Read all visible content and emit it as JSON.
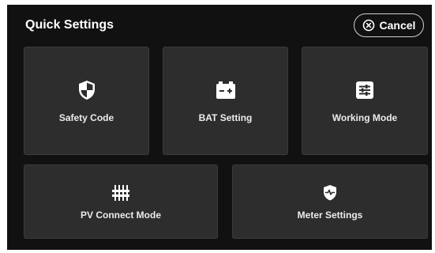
{
  "header": {
    "title": "Quick Settings",
    "cancel_label": "Cancel",
    "cancel_icon": "close-circle-icon"
  },
  "tiles": [
    {
      "label": "Safety Code",
      "icon": "shield-icon"
    },
    {
      "label": "BAT Setting",
      "icon": "battery-icon"
    },
    {
      "label": "Working Mode",
      "icon": "sliders-icon"
    },
    {
      "label": "PV Connect Mode",
      "icon": "pv-connector-icon"
    },
    {
      "label": "Meter Settings",
      "icon": "meter-shield-icon"
    }
  ],
  "colors": {
    "background": "#111111",
    "tile": "#2d2d2d",
    "text": "#ffffff"
  }
}
